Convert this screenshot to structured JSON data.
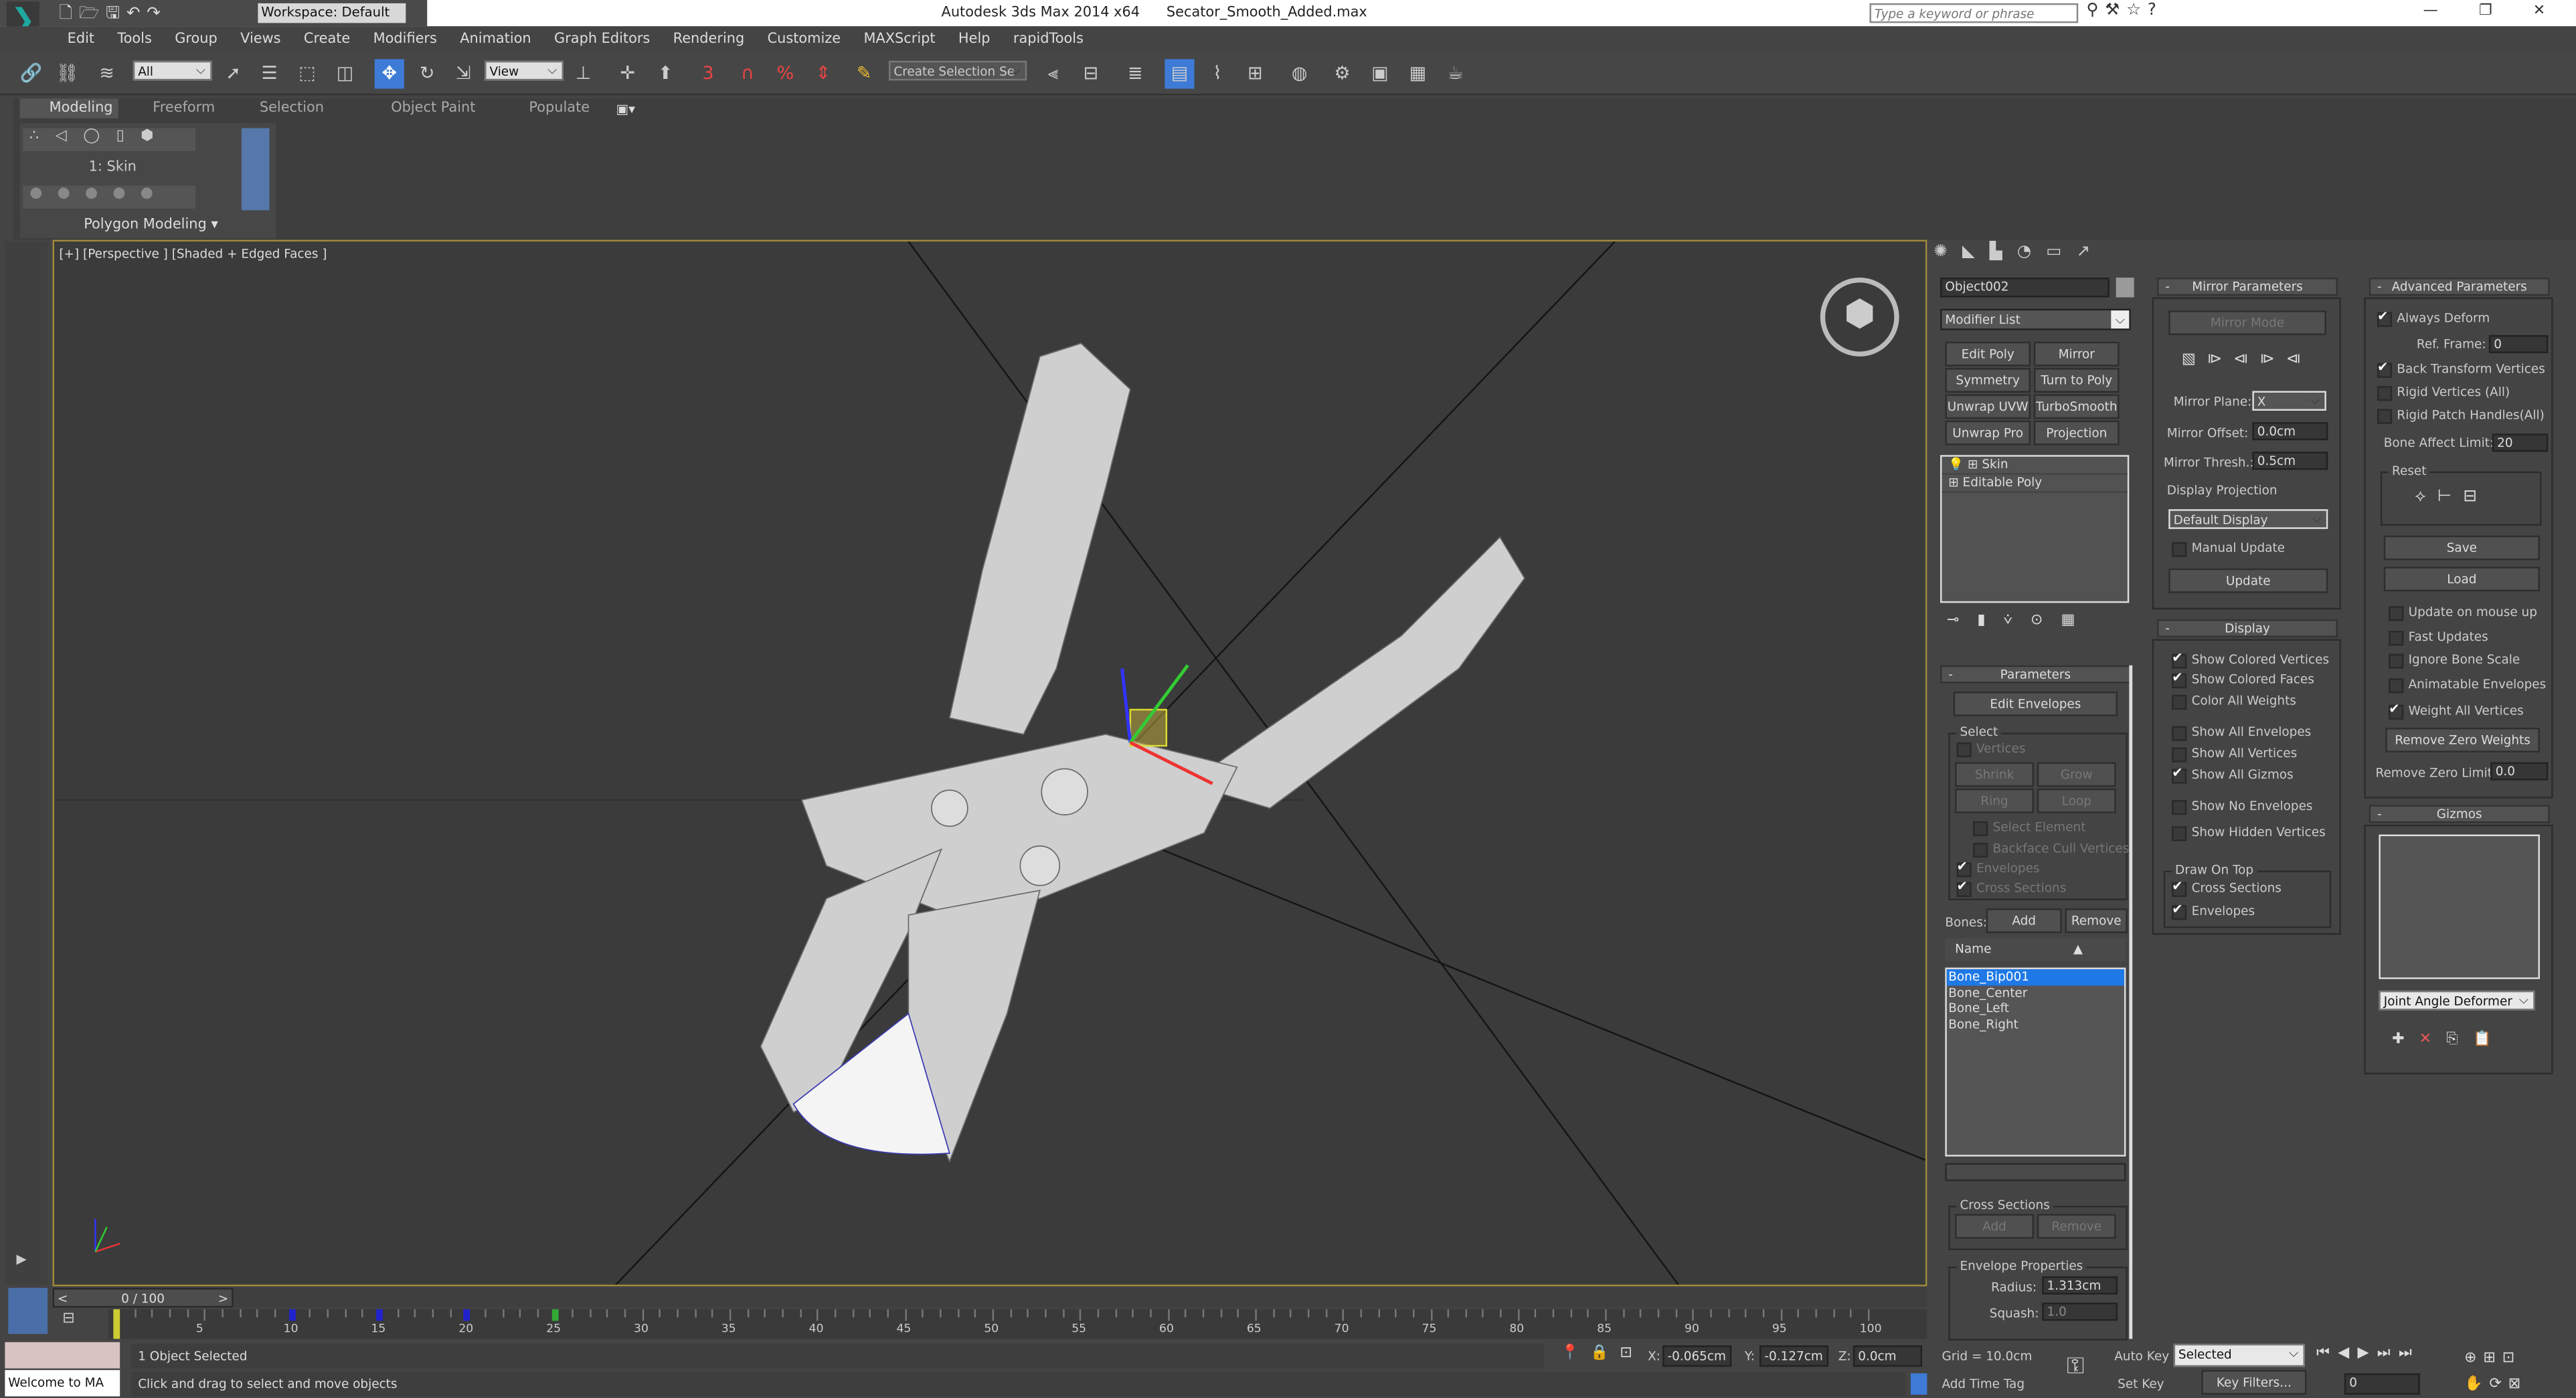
{
  "title_bar": {
    "app": "Autodesk 3ds Max  2014 x64",
    "file": "Secator_Smooth_Added.max",
    "workspace": "Workspace: Default",
    "search_placeholder": "Type a keyword or phrase",
    "window_buttons": [
      "—",
      "❐",
      "✕"
    ]
  },
  "menu": [
    "Edit",
    "Tools",
    "Group",
    "Views",
    "Create",
    "Modifiers",
    "Animation",
    "Graph Editors",
    "Rendering",
    "Customize",
    "MAXScript",
    "Help",
    "rapidTools"
  ],
  "toolbar": {
    "selection_filter": "All",
    "ref_coord": "View",
    "named_selection": "Create Selection Se",
    "snap_labels": [
      "3",
      "%"
    ]
  },
  "ribbon": {
    "tabs": [
      "Modeling",
      "Freeform",
      "Selection",
      "Object Paint",
      "Populate"
    ],
    "active_tab": "Modeling",
    "modifier_label": "1: Skin",
    "panel_label": "Polygon Modeling ▾"
  },
  "viewport": {
    "label": "[+] [Perspective ] [Shaded + Edged Faces ]",
    "border_color": "#a08a3c",
    "bg": "#3d3d3d"
  },
  "command_panel": {
    "object_name": "Object002",
    "object_color": "#9a9a9a",
    "modifier_list": "Modifier List",
    "modifier_buttons": [
      "Edit Poly",
      "Mirror",
      "Symmetry",
      "Turn to Poly",
      "Unwrap UVW",
      "TurboSmooth",
      "Unwrap Pro",
      "Projection"
    ],
    "stack": [
      "Skin",
      "Editable Poly"
    ],
    "parameters": {
      "title": "Parameters",
      "edit_envelopes": "Edit Envelopes",
      "select_group": "Select",
      "vertices": "Vertices",
      "shrink": "Shrink",
      "grow": "Grow",
      "ring": "Ring",
      "loop": "Loop",
      "select_element": "Select Element",
      "backface": "Backface Cull Vertices",
      "envelopes": "Envelopes",
      "cross_sections": "Cross Sections",
      "bones_label": "Bones:",
      "add": "Add",
      "remove": "Remove",
      "name_header": "Name",
      "bones": [
        "Bone_Bip001",
        "Bone_Center",
        "Bone_Left",
        "Bone_Right"
      ],
      "selected_bone": "Bone_Bip001",
      "cs_group": "Cross Sections",
      "cs_add": "Add",
      "cs_remove": "Remove",
      "env_group": "Envelope Properties",
      "radius_label": "Radius:",
      "radius": "1.313cm",
      "squash_label": "Squash:",
      "squash": "1.0"
    }
  },
  "mirror": {
    "title": "Mirror Parameters",
    "mirror_mode": "Mirror Mode",
    "plane_label": "Mirror Plane:",
    "plane": "X",
    "offset_label": "Mirror Offset:",
    "offset": "0.0cm",
    "thresh_label": "Mirror Thresh.:",
    "thresh": "0.5cm",
    "projection_label": "Display Projection",
    "projection": "Default Display",
    "manual_update": "Manual Update",
    "update": "Update"
  },
  "display": {
    "title": "Display",
    "items": [
      {
        "label": "Show Colored Vertices",
        "checked": true
      },
      {
        "label": "Show Colored Faces",
        "checked": true
      },
      {
        "label": "Color All Weights",
        "checked": false
      },
      {
        "label": "Show All Envelopes",
        "checked": false
      },
      {
        "label": "Show All Vertices",
        "checked": false
      },
      {
        "label": "Show All Gizmos",
        "checked": true
      },
      {
        "label": "Show No Envelopes",
        "checked": false
      },
      {
        "label": "Show Hidden Vertices",
        "checked": false
      }
    ],
    "draw_on_top": "Draw On Top",
    "dot_items": [
      {
        "label": "Cross Sections",
        "checked": true
      },
      {
        "label": "Envelopes",
        "checked": true
      }
    ]
  },
  "advanced": {
    "title": "Advanced Parameters",
    "always_deform": "Always Deform",
    "ref_frame_label": "Ref. Frame:",
    "ref_frame": "0",
    "back_transform": "Back Transform Vertices",
    "rigid_vertices": "Rigid Vertices (All)",
    "rigid_patch": "Rigid Patch Handles(All)",
    "bone_limit_label": "Bone Affect Limit:",
    "bone_limit": "20",
    "reset": "Reset",
    "save": "Save",
    "load": "Load",
    "options": [
      {
        "label": "Update on mouse up",
        "checked": false
      },
      {
        "label": "Fast Updates",
        "checked": false
      },
      {
        "label": "Ignore Bone Scale",
        "checked": false
      },
      {
        "label": "Animatable Envelopes",
        "checked": false
      },
      {
        "label": "Weight All Vertices",
        "checked": true
      }
    ],
    "remove_zero": "Remove Zero Weights",
    "zero_limit_label": "Remove Zero Limit:",
    "zero_limit": "0.0"
  },
  "gizmos": {
    "title": "Gizmos",
    "deformer": "Joint Angle Deformer"
  },
  "timeline": {
    "frame": "0 / 100",
    "current": 0,
    "total": 100,
    "ticks": [
      "5",
      "10",
      "15",
      "20",
      "25",
      "30",
      "35",
      "40",
      "45",
      "50",
      "55",
      "60",
      "65",
      "70",
      "75",
      "80",
      "85",
      "90",
      "95",
      "100"
    ],
    "keys": [
      10,
      15,
      20,
      25
    ]
  },
  "status": {
    "maxscript": "Welcome to MA",
    "selected": "1 Object Selected",
    "prompt": "Click and drag to select and move objects",
    "x_label": "X:",
    "x": "-0.065cm",
    "y_label": "Y:",
    "y": "-0.127cm",
    "z_label": "Z:",
    "z": "0.0cm",
    "grid": "Grid = 10.0cm",
    "add_time_tag": "Add Time Tag",
    "auto_key": "Auto Key",
    "set_key": "Set Key",
    "key_mode": "Selected",
    "key_filters": "Key Filters...",
    "frame": "0"
  }
}
